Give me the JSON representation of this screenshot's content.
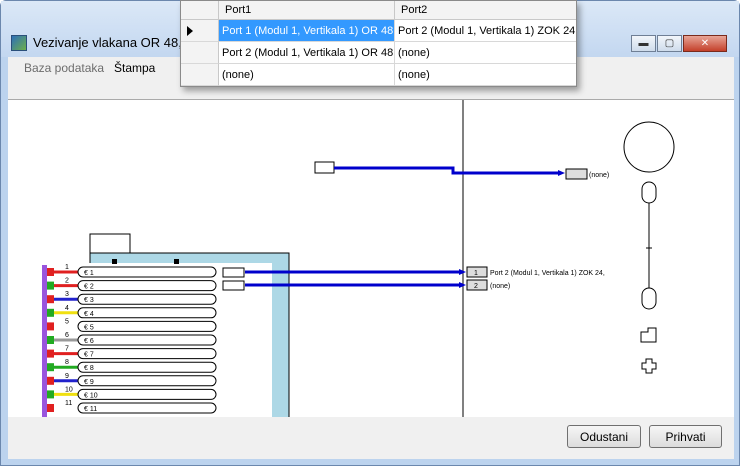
{
  "window": {
    "title": "Vezivanje vlakana OR 48,"
  },
  "menu": {
    "items": [
      "Baza podataka",
      "Štampa"
    ]
  },
  "buttons": {
    "cancel": "Odustani",
    "accept": "Prihvati"
  },
  "dropdown": {
    "headers": [
      "Port1",
      "Port2"
    ],
    "rows": [
      {
        "port1": "Port 1 (Modul 1, Vertikala 1) OR 48,",
        "port2": "Port 2 (Modul 1, Vertikala 1) ZOK 24,",
        "selected": true
      },
      {
        "port1": "Port 2 (Modul 1, Vertikala 1) OR 48,",
        "port2": "(none)",
        "selected": false
      },
      {
        "port1": "(none)",
        "port2": "(none)",
        "selected": false
      }
    ]
  },
  "diagram": {
    "top_link_label": "(none)",
    "fibers": [
      {
        "num": "1",
        "color": "#e02020"
      },
      {
        "num": "2",
        "color": "#e02020"
      },
      {
        "num": "3",
        "color": "#2222cc"
      },
      {
        "num": "4",
        "color": "#f0e010"
      },
      {
        "num": "5",
        "color": "#ffffff"
      },
      {
        "num": "6",
        "color": "#999999"
      },
      {
        "num": "7",
        "color": "#e02020"
      },
      {
        "num": "8",
        "color": "#22aa22"
      },
      {
        "num": "9",
        "color": "#2222cc"
      },
      {
        "num": "10",
        "color": "#f0e010"
      },
      {
        "num": "11",
        "color": "#ffffff"
      }
    ],
    "right_ports": [
      {
        "num": "1",
        "label": "Port 2 (Modul 1, Vertikala 1) ZOK 24,"
      },
      {
        "num": "2",
        "label": "(none)"
      }
    ]
  }
}
